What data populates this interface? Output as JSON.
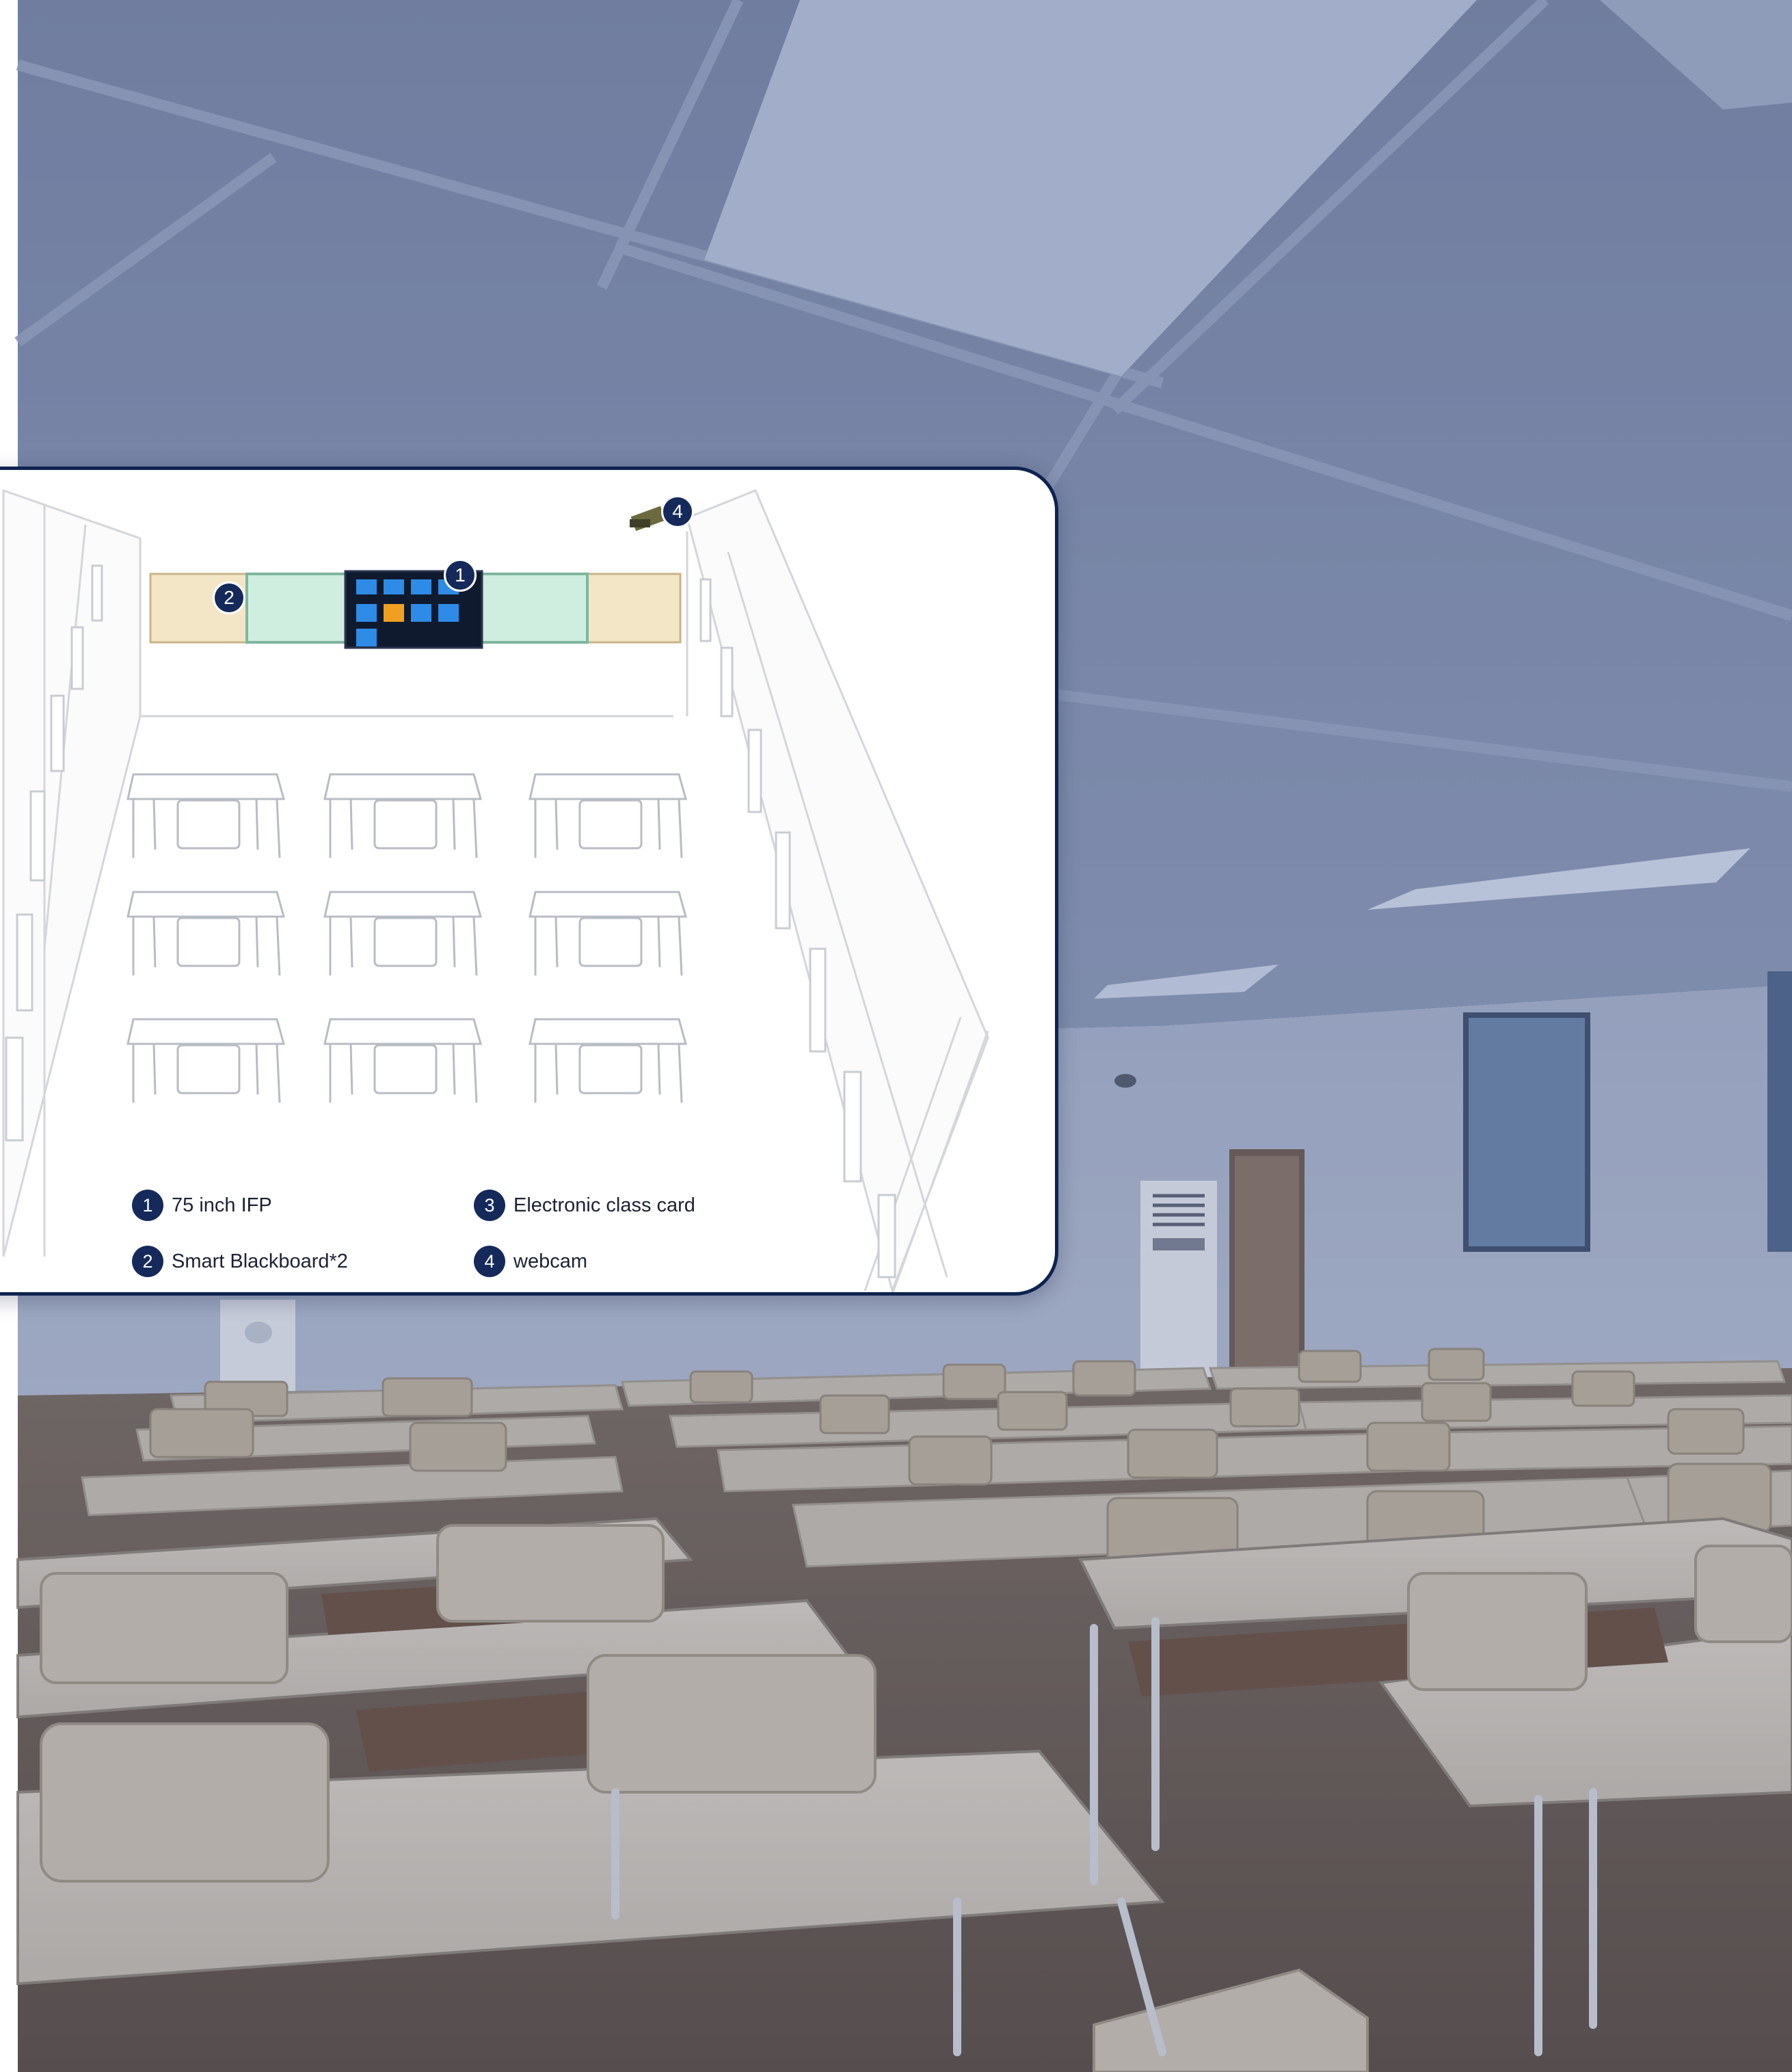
{
  "legend": {
    "items": [
      {
        "num": "1",
        "label": "75 inch IFP"
      },
      {
        "num": "2",
        "label": "Smart Blackboard*2"
      },
      {
        "num": "3",
        "label": "Electronic class card"
      },
      {
        "num": "4",
        "label": "webcam"
      }
    ]
  },
  "markers": [
    {
      "num": "1"
    },
    {
      "num": "2"
    },
    {
      "num": "4"
    }
  ],
  "colors": {
    "overlay": "#5a6a95",
    "card_border": "#0f2350",
    "badge": "#152a5a",
    "desk": "#e2d8c8",
    "floor": "#6d5a48",
    "blackboard": "#cfeee0",
    "cork": "#f3e6c7"
  }
}
